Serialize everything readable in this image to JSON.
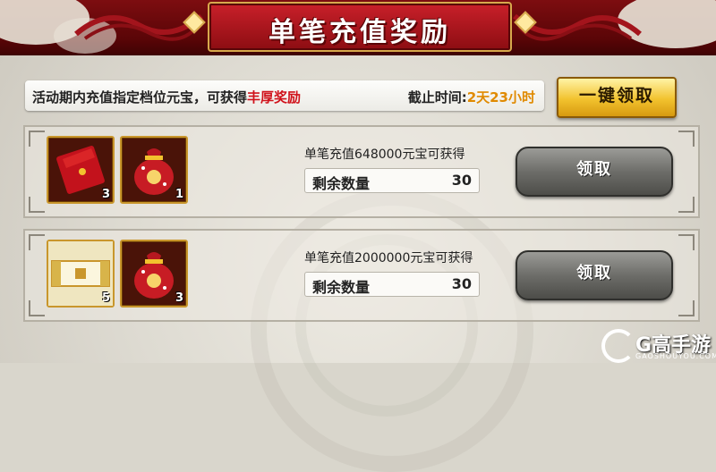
{
  "header": {
    "title": "单笔充值奖励"
  },
  "info": {
    "desc_prefix": "活动期内充值指定档位元宝，可获得",
    "desc_highlight": "丰厚奖励",
    "deadline_label": "截止时间:",
    "deadline_value": "2天23小时"
  },
  "claim_all_label": "一键领取",
  "rows": [
    {
      "condition": "单笔充值648000元宝可获得",
      "remain_label": "剩余数量",
      "remain_value": "30",
      "claim_label": "领取",
      "items": [
        {
          "icon": "red-envelope-icon",
          "qty": "3"
        },
        {
          "icon": "lucky-bag-icon",
          "qty": "1"
        }
      ]
    },
    {
      "condition": "单笔充值2000000元宝可获得",
      "remain_label": "剩余数量",
      "remain_value": "30",
      "claim_label": "领取",
      "items": [
        {
          "icon": "gold-scroll-icon",
          "qty": "5"
        },
        {
          "icon": "lucky-bag-icon",
          "qty": "3"
        }
      ]
    }
  ],
  "watermark": {
    "name": "G高手游",
    "sub": "GAOSHOUYOU.COM"
  },
  "colors": {
    "header": "#7d0d10",
    "highlight": "#d0121b",
    "deadline": "#e08a00",
    "gold_button": "#f2c22e"
  }
}
